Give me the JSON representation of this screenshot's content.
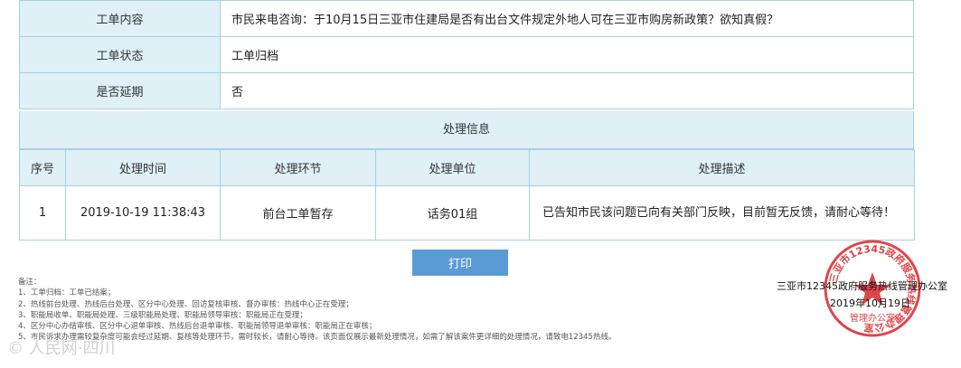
{
  "info": [
    {
      "label": "工单内容",
      "value": "市民来电咨询：于10月15日三亚市住建局是否有出台文件规定外地人可在三亚市购房新政策？欲知真假？"
    },
    {
      "label": "工单状态",
      "value": "工单归档"
    },
    {
      "label": "是否延期",
      "value": "否"
    }
  ],
  "section_title": "处理信息",
  "process_table": {
    "headers": [
      "序号",
      "处理时间",
      "处理环节",
      "处理单位",
      "处理描述"
    ],
    "rows": [
      {
        "no": "1",
        "time": "2019-10-19 11:38:43",
        "step": "前台工单暂存",
        "unit": "话务01组",
        "desc": "已告知市民该问题已向有关部门反映，目前暂无反馈，请耐心等待！"
      }
    ]
  },
  "print_label": "打印",
  "notes": {
    "title": "备注：",
    "lines": [
      "1、工单归档：工单已结案；",
      "2、热线前台处理、热线后台处理、区分中心处理、回访复核审核、督办审核：热线中心正在受理；",
      "3、职能局收单、职能局处理、三级职能局处理、职能局领导审核：职能局正在受理；",
      "4、区分中心办结审核、区分中心退单审核、热线后台退单审核、职能局领导退单审核：职能局正在审核；",
      "5、市民诉求办理需较复杂度可能会经过延期、复核等处理环节，需时较长，请耐心等待。该页面仅展示最新处理情况，如需了解该案件更详细的处理情况，请致电12345热线。"
    ]
  },
  "signature": {
    "office": "三亚市12345政府服务热线管理办公室",
    "date": "2019年10月19日"
  },
  "stamp": {
    "ring_text": "三亚市12345政府服务热线管理办公室",
    "center_text": "管理办公室",
    "color": "#d9262a"
  },
  "watermark": "© 人民网·四川"
}
